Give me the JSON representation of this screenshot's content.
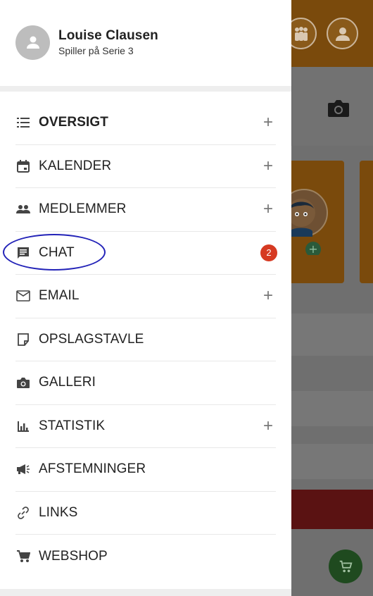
{
  "profile": {
    "name": "Louise Clausen",
    "role": "Spiller på Serie 3"
  },
  "menu": [
    {
      "label": "OVERSIGT",
      "icon": "list-icon",
      "bold": true,
      "plus": "+"
    },
    {
      "label": "KALENDER",
      "icon": "calendar-icon",
      "plus": "+"
    },
    {
      "label": "MEDLEMMER",
      "icon": "people-icon",
      "plus": "+"
    },
    {
      "label": "CHAT",
      "icon": "chat-icon",
      "badge": "2"
    },
    {
      "label": "EMAIL",
      "icon": "mail-icon",
      "plus": "+"
    },
    {
      "label": "OPSLAGSTAVLE",
      "icon": "note-icon"
    },
    {
      "label": "GALLERI",
      "icon": "camera-icon"
    },
    {
      "label": "STATISTIK",
      "icon": "bar-chart-icon",
      "plus": "+"
    },
    {
      "label": "AFSTEMNINGER",
      "icon": "megaphone-icon"
    },
    {
      "label": "LINKS",
      "icon": "link-icon"
    },
    {
      "label": "WEBSHOP",
      "icon": "cart-icon"
    }
  ],
  "colors": {
    "badge": "#d63a22",
    "highlight": "#2323b8",
    "topbar": "#7a4a0c"
  }
}
